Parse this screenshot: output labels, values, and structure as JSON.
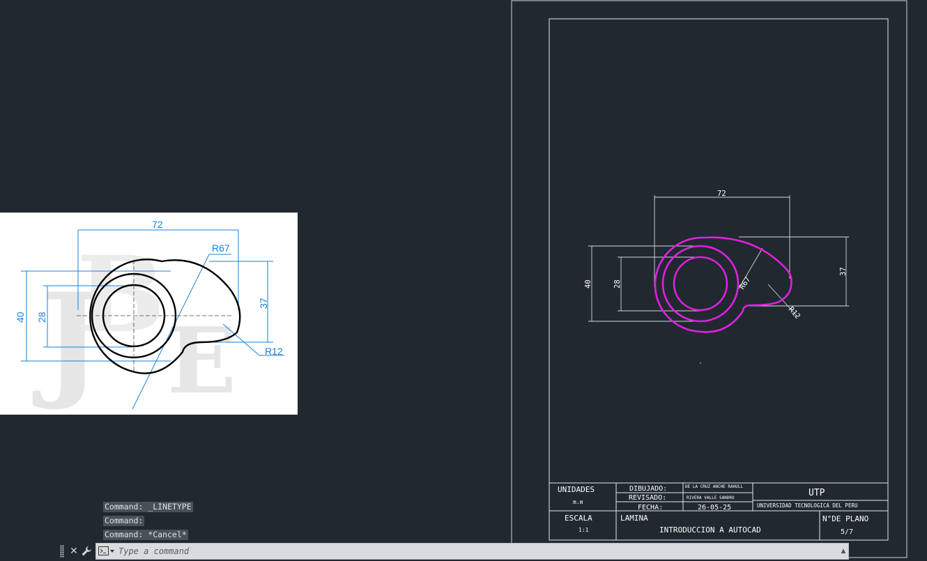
{
  "reference_image": {
    "dims": {
      "width": "72",
      "radius_large": "R67",
      "height_right": "37",
      "height_outer": "40",
      "height_inner": "28",
      "radius_small": "R12"
    },
    "watermark": "JBE"
  },
  "drawing": {
    "dims": {
      "width": "72",
      "radius_large": "R67",
      "height_right": "37",
      "height_outer": "40",
      "height_inner": "28",
      "radius_small": "R12"
    }
  },
  "title_block": {
    "unidades_label": "UNIDADES",
    "unidades_value": "m.m",
    "dibujado_label": "DIBUJADO:",
    "dibujado_value": "DE LA CRUZ ANCHE RAHULL",
    "revisado_label": "REVISADO:",
    "revisado_value": "RIVERA VALLE SANDRO",
    "fecha_label": "FECHA:",
    "fecha_value": "26-05-25",
    "org_short": "UTP",
    "org_full": "UNIVERSIDAD TECNOLOGICA DEL PERU",
    "escala_label": "ESCALA",
    "escala_value": "1:1",
    "lamina_label": "LAMINA",
    "lamina_value": "INTRODUCCION A AUTOCAD",
    "plano_label": "N°DE PLANO",
    "plano_value": "5/7"
  },
  "command_line": {
    "history": [
      "Command: _LINETYPE",
      "Command:",
      "Command: *Cancel*"
    ],
    "placeholder": "Type a command"
  },
  "colors": {
    "background": "#212830",
    "geometry": "#e020e0",
    "reference_dims": "#1a7fd6"
  }
}
